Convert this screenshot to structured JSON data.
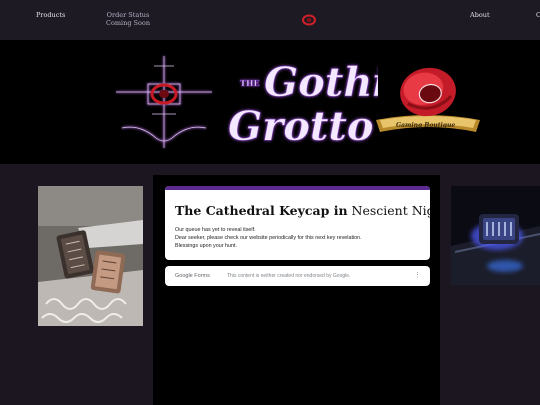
{
  "nav": {
    "products": "Products",
    "order_status_line1": "Order Status",
    "order_status_line2": "Coming Soon",
    "about": "About",
    "cut_off": "C"
  },
  "form": {
    "title_bold": "The Cathedral Keycap in",
    "title_rest": "Nescient Nigredo",
    "line1": "Our queue has yet to reveal itself.",
    "line2": "Dear seeker, please check our website periodically for this next key revelation.",
    "line3": "Blessings upon your hunt.",
    "footer_brand": "Google Forms",
    "footer_note": "This content is neither created nor endorsed by Google.",
    "footer_more": "⋮"
  },
  "colors": {
    "nav_bg": "#1e1a24",
    "page_bg": "#1b1620",
    "accent_purple": "#5a2a90",
    "logo_red": "#d0202a"
  },
  "icons": {
    "nav_logo": "red-dice-logo-icon",
    "banner_left": "gothic-cross-icon",
    "banner_right": "red-dice-badge-icon"
  }
}
